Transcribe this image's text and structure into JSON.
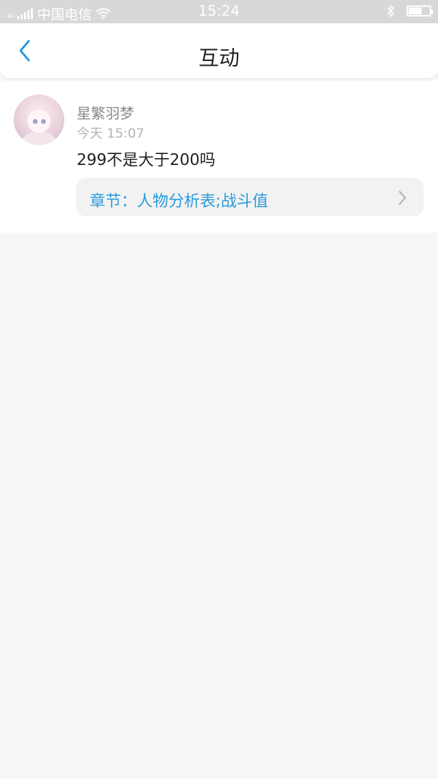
{
  "status_bar": {
    "network": "4G",
    "carrier": "中国电信",
    "time": "15:24",
    "battery_level": 0.6
  },
  "nav": {
    "title": "互动",
    "back_icon": "chevron-left-icon",
    "accent_color": "#2a9bdc"
  },
  "comment": {
    "username": "星繁羽梦",
    "time": "今天 15:07",
    "text": "299不是大于200吗",
    "chapter_link": {
      "label": "章节：人物分析表;战斗值",
      "icon": "chevron-right-icon"
    }
  }
}
